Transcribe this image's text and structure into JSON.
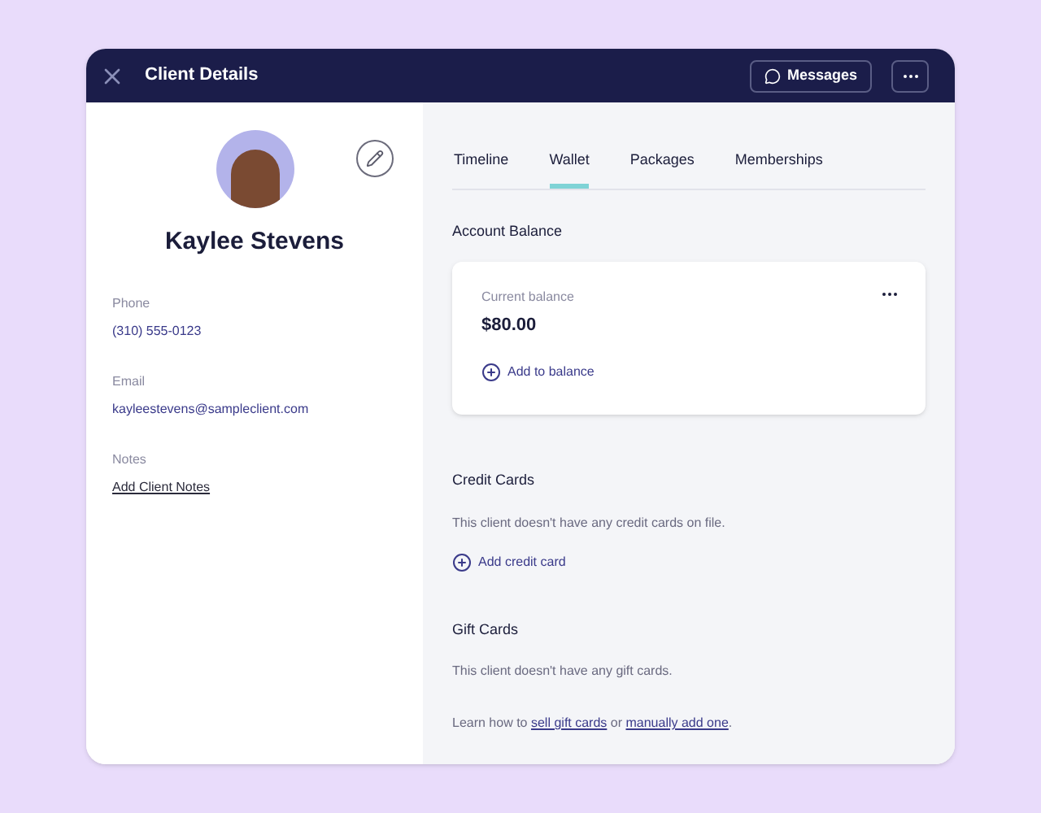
{
  "header": {
    "title": "Client Details",
    "messages_button": "Messages"
  },
  "profile": {
    "name": "Kaylee Stevens",
    "fields": [
      {
        "label": "Phone",
        "value": "(310) 555-0123",
        "kind": "text"
      },
      {
        "label": "Email",
        "value": "kayleestevens@sampleclient.com",
        "kind": "text"
      },
      {
        "label": "Notes",
        "value": "Add Client Notes",
        "kind": "link"
      }
    ]
  },
  "tabs": [
    {
      "label": "Timeline",
      "selected": false
    },
    {
      "label": "Wallet",
      "selected": true
    },
    {
      "label": "Packages",
      "selected": false
    },
    {
      "label": "Memberships",
      "selected": false
    }
  ],
  "account_balance": {
    "heading": "Account Balance",
    "label": "Current balance",
    "amount": "$80.00",
    "action": "Add to balance"
  },
  "credit_cards": {
    "heading": "Credit Cards",
    "empty_message": "This client doesn't have any credit cards on file.",
    "action": "Add credit card"
  },
  "gift_cards": {
    "heading": "Gift Cards",
    "empty_message": "This client doesn't have any gift cards.",
    "learn_more": {
      "prefix": "Learn how to ",
      "link_1": "sell gift cards",
      "middle": " or ",
      "link_2": "manually add one",
      "suffix": "."
    }
  }
}
